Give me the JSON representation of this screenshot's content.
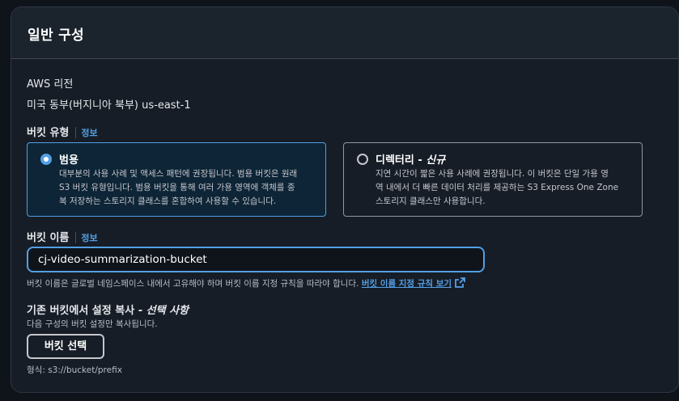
{
  "section": {
    "title": "일반 구성"
  },
  "region": {
    "label": "AWS 리전",
    "value": "미국 동부(버지니아 북부) us-east-1"
  },
  "bucket_type": {
    "label": "버킷 유형",
    "info": "정보",
    "options": [
      {
        "title": "범용",
        "title_suffix": "",
        "selected": true,
        "desc_lines": [
          "대부분의 사용 사례 및 액세스 패턴에 권장됩니다. 범용 버킷은 원래",
          "S3 버킷 유형입니다. 범용 버킷을 통해 여러 가용 영역에 객체를 중",
          "복 저장하는 스토리지 클래스를 혼합하여 사용할 수 있습니다."
        ]
      },
      {
        "title": "디렉터리 - ",
        "title_suffix": "신규",
        "selected": false,
        "desc_lines": [
          "지연 시간이 짧은 사용 사례에 권장됩니다. 이 버킷은 단일 가용 영",
          "역 내에서 더 빠른 데이터 처리를 제공하는 S3 Express One Zone",
          "스토리지 클래스만 사용합니다."
        ]
      }
    ]
  },
  "bucket_name": {
    "label": "버킷 이름",
    "info": "정보",
    "value": "cj-video-summarization-bucket",
    "hint": "버킷 이름은 글로벌 네임스페이스 내에서 고유해야 하며 버킷 이름 지정 규칙을 따라야 합니다. ",
    "hint_link": "버킷 이름 지정 규칙 보기"
  },
  "copy_settings": {
    "label": "기존 버킷에서 설정 복사 - ",
    "label_optional": "선택 사항",
    "desc": "다음 구성의 버킷 설정만 복사됩니다.",
    "button": "버킷 선택",
    "format": "형식: s3://bucket/prefix"
  },
  "colors": {
    "accent": "#539fe5",
    "panel": "#161d26",
    "selected_card": "#0d2536"
  }
}
